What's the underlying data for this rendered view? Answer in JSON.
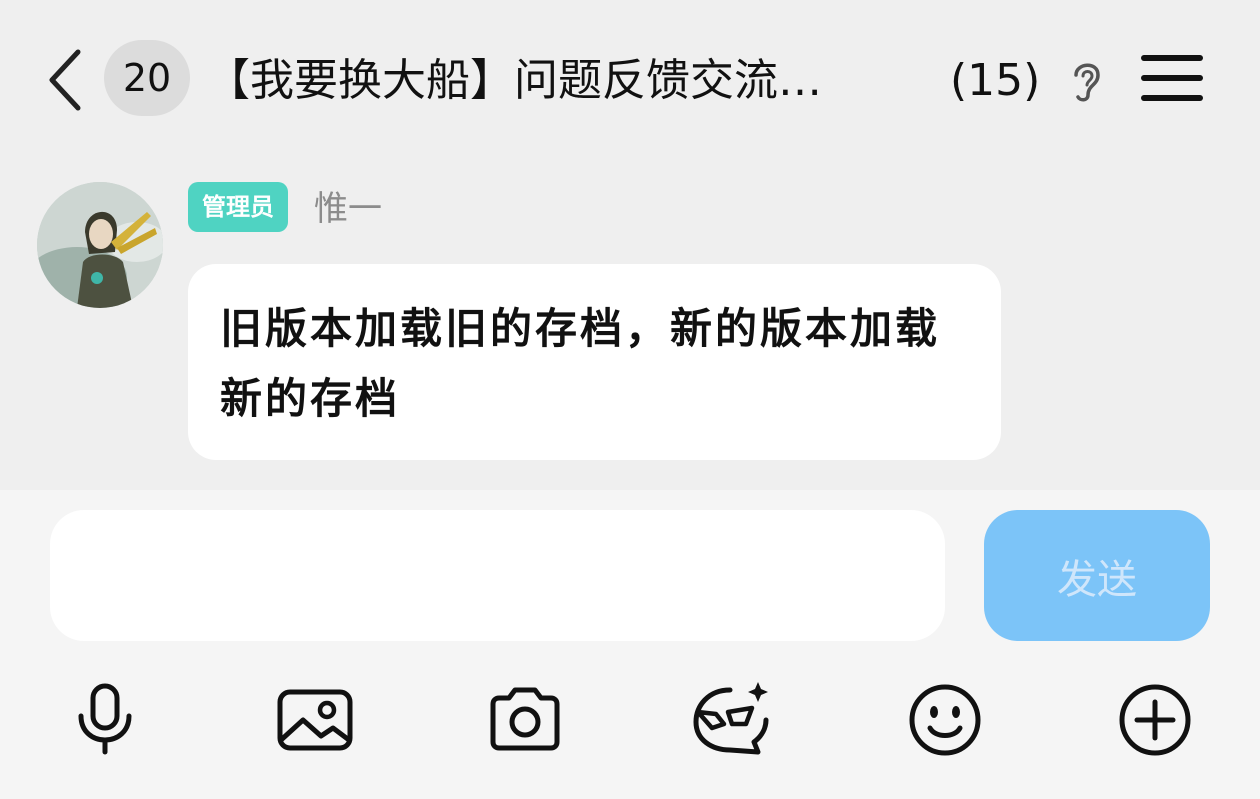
{
  "header": {
    "unread_count": "20",
    "title": "【我要换大船】问题反馈交流…",
    "member_count": "(15)"
  },
  "message": {
    "role_badge": "管理员",
    "sender_name": "惟一",
    "text": "旧版本加载旧的存档，新的版本加载新的存档"
  },
  "composer": {
    "input_value": "",
    "send_label": "发送"
  },
  "toolbar": {
    "icons": [
      "microphone-icon",
      "image-icon",
      "camera-icon",
      "sticker-icon",
      "emoji-icon",
      "plus-icon"
    ]
  },
  "colors": {
    "background": "#efefef",
    "bubble": "#ffffff",
    "role_badge": "#4fd3c2",
    "send_button": "#7cc4f8"
  }
}
